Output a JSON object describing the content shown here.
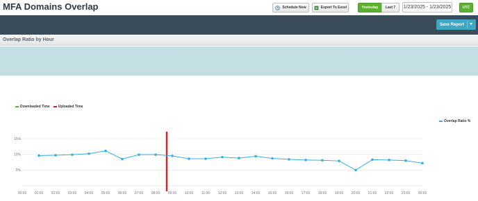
{
  "header": {
    "title": "MFA Domains Overlap",
    "schedule_label": "Schedule Now",
    "excel_label": "Export To Excel",
    "yesterday_label": "Yesterday",
    "last7_label": "Last 7",
    "date_range": "1/23/2025 - 1/23/2025",
    "utc_label": "UTC"
  },
  "toolbar": {
    "save_report_label": "Save Report"
  },
  "section": {
    "title": "Overlap Ratio by Hour"
  },
  "legend": {
    "downloaded": "Downloaded Time",
    "uploaded": "Uploaded Time",
    "overlap": "Overlap Ratio %"
  },
  "colors": {
    "accent_green": "#5cb030",
    "series_blue": "#3aaee0",
    "uploaded_red": "#e02020",
    "downloaded_green": "#5cb030"
  },
  "chart_data": {
    "type": "line",
    "x": [
      "00:00",
      "01:00",
      "02:00",
      "03:00",
      "04:00",
      "05:00",
      "06:00",
      "07:00",
      "08:00",
      "09:00",
      "10:00",
      "11:00",
      "12:00",
      "13:00",
      "14:00",
      "15:00",
      "16:00",
      "17:00",
      "18:00",
      "19:00",
      "20:00",
      "21:00",
      "22:00",
      "23:00",
      "00:00"
    ],
    "series": [
      {
        "name": "Overlap Ratio %",
        "points": [
          {
            "x": "01:00",
            "y": 9.6
          },
          {
            "x": "02:00",
            "y": 9.7
          },
          {
            "x": "03:00",
            "y": 9.9
          },
          {
            "x": "04:00",
            "y": 10.2
          },
          {
            "x": "05:00",
            "y": 11.1
          },
          {
            "x": "06:00",
            "y": 8.5
          },
          {
            "x": "07:00",
            "y": 9.9
          },
          {
            "x": "08:00",
            "y": 9.9
          },
          {
            "x": "09:00",
            "y": 9.5
          },
          {
            "x": "10:00",
            "y": 8.6
          },
          {
            "x": "11:00",
            "y": 8.6
          },
          {
            "x": "12:00",
            "y": 9.1
          },
          {
            "x": "13:00",
            "y": 8.8
          },
          {
            "x": "14:00",
            "y": 9.4
          },
          {
            "x": "15:00",
            "y": 8.7
          },
          {
            "x": "16:00",
            "y": 8.4
          },
          {
            "x": "17:00",
            "y": 8.2
          },
          {
            "x": "18:00",
            "y": 8.1
          },
          {
            "x": "19:00",
            "y": 7.9
          },
          {
            "x": "20:00",
            "y": 5.0
          },
          {
            "x": "21:00",
            "y": 8.3
          },
          {
            "x": "22:00",
            "y": 8.2
          },
          {
            "x": "23:00",
            "y": 8.0
          },
          {
            "x": "00:00",
            "y": 7.2
          }
        ]
      }
    ],
    "uploaded_time_marker": "08:40",
    "yticks": [
      "15%",
      "10%",
      "5%"
    ],
    "ylim": [
      0,
      15
    ],
    "grid": true,
    "legend_position": "top-left"
  }
}
